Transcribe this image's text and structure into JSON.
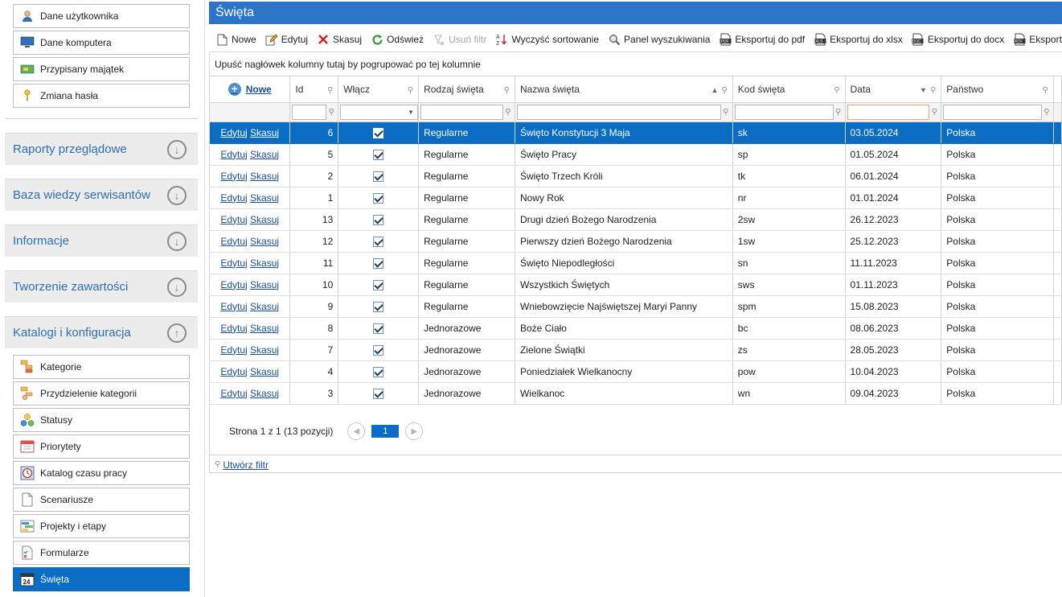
{
  "sidebar": {
    "top_buttons": [
      {
        "label": "Dane użytkownika",
        "icon": "user-icon"
      },
      {
        "label": "Dane komputera",
        "icon": "monitor-icon"
      },
      {
        "label": "Przypisany majątek",
        "icon": "asset-icon"
      },
      {
        "label": "Zmiana hasła",
        "icon": "key-icon"
      }
    ],
    "sections": [
      {
        "label": "Raporty przeglądowe",
        "state": "collapsed"
      },
      {
        "label": "Baza wiedzy serwisantów",
        "state": "collapsed"
      },
      {
        "label": "Informacje",
        "state": "collapsed"
      },
      {
        "label": "Tworzenie zawartości",
        "state": "collapsed"
      },
      {
        "label": "Katalogi i konfiguracja",
        "state": "expanded"
      }
    ],
    "config_items": [
      {
        "label": "Kategorie",
        "icon": "category-icon"
      },
      {
        "label": "Przydzielenie kategorii",
        "icon": "category-assign-icon"
      },
      {
        "label": "Statusy",
        "icon": "status-icon"
      },
      {
        "label": "Priorytety",
        "icon": "priority-icon"
      },
      {
        "label": "Katalog czasu pracy",
        "icon": "clock-icon"
      },
      {
        "label": "Scenariusze",
        "icon": "document-icon"
      },
      {
        "label": "Projekty i etapy",
        "icon": "gantt-icon"
      },
      {
        "label": "Formularze",
        "icon": "form-icon"
      },
      {
        "label": "Święta",
        "icon": "calendar-icon",
        "active": true
      }
    ]
  },
  "main": {
    "title": "Święta",
    "toolbar": {
      "new": "Nowe",
      "edit": "Edytuj",
      "delete": "Skasuj",
      "refresh": "Odśwież",
      "clear_filter": "Usuń filtr",
      "clear_sort": "Wyczyść sortowanie",
      "search_panel": "Panel wyszukiwania",
      "export_pdf": "Eksportuj do pdf",
      "export_xlsx": "Eksportuj do xlsx",
      "export_docx": "Eksportuj do docx",
      "export_more": "Eksportuj"
    },
    "group_hint": "Upuść nagłówek kolumny tutaj by pogrupować po tej kolumnie",
    "grid": {
      "new_link": "Nowe",
      "row_edit": "Edytuj",
      "row_delete": "Skasuj",
      "columns": [
        "Id",
        "Włącz",
        "Rodzaj święta",
        "Nazwa święta",
        "Kod święta",
        "Data",
        "Państwo"
      ],
      "rows": [
        {
          "id": "6",
          "enabled": true,
          "type": "Regularne",
          "name": "Święto Konstytucji 3 Maja",
          "code": "sk",
          "date": "03.05.2024",
          "country": "Polska",
          "selected": true
        },
        {
          "id": "5",
          "enabled": true,
          "type": "Regularne",
          "name": "Święto Pracy",
          "code": "sp",
          "date": "01.05.2024",
          "country": "Polska"
        },
        {
          "id": "2",
          "enabled": true,
          "type": "Regularne",
          "name": "Święto Trzech Króli",
          "code": "tk",
          "date": "06.01.2024",
          "country": "Polska"
        },
        {
          "id": "1",
          "enabled": true,
          "type": "Regularne",
          "name": "Nowy Rok",
          "code": "nr",
          "date": "01.01.2024",
          "country": "Polska"
        },
        {
          "id": "13",
          "enabled": true,
          "type": "Regularne",
          "name": "Drugi dzień Bożego Narodzenia",
          "code": "2sw",
          "date": "26.12.2023",
          "country": "Polska"
        },
        {
          "id": "12",
          "enabled": true,
          "type": "Regularne",
          "name": "Pierwszy dzień Bożego Narodzenia",
          "code": "1sw",
          "date": "25.12.2023",
          "country": "Polska"
        },
        {
          "id": "11",
          "enabled": true,
          "type": "Regularne",
          "name": "Święto Niepodległości",
          "code": "sn",
          "date": "11.11.2023",
          "country": "Polska"
        },
        {
          "id": "10",
          "enabled": true,
          "type": "Regularne",
          "name": "Wszystkich Świętych",
          "code": "sws",
          "date": "01.11.2023",
          "country": "Polska"
        },
        {
          "id": "9",
          "enabled": true,
          "type": "Regularne",
          "name": "Wniebowzięcie Najświętszej Maryi Panny",
          "code": "spm",
          "date": "15.08.2023",
          "country": "Polska"
        },
        {
          "id": "8",
          "enabled": true,
          "type": "Jednorazowe",
          "name": "Boże Ciało",
          "code": "bc",
          "date": "08.06.2023",
          "country": "Polska"
        },
        {
          "id": "7",
          "enabled": true,
          "type": "Jednorazowe",
          "name": "Zielone Świątki",
          "code": "zs",
          "date": "28.05.2023",
          "country": "Polska"
        },
        {
          "id": "4",
          "enabled": true,
          "type": "Jednorazowe",
          "name": "Poniedziałek Wielkanocny",
          "code": "pow",
          "date": "10.04.2023",
          "country": "Polska"
        },
        {
          "id": "3",
          "enabled": true,
          "type": "Jednorazowe",
          "name": "Wielkanoc",
          "code": "wn",
          "date": "09.04.2023",
          "country": "Polska"
        }
      ]
    },
    "pager": {
      "summary": "Strona 1 z 1 (13 pozycji)",
      "current_page": "1"
    },
    "create_filter": "Utwórz filtr"
  }
}
